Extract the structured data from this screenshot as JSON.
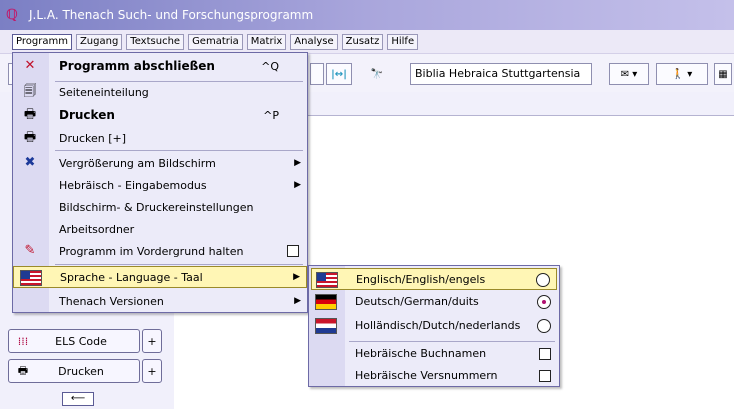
{
  "window": {
    "title": "J.L.A. Thenach Such- und Forschungsprogramm"
  },
  "menubar": {
    "items": [
      "Programm",
      "Zugang",
      "Textsuche",
      "Gematria",
      "Matrix",
      "Analyse",
      "Zusatz",
      "Hilfe"
    ]
  },
  "toolbar": {
    "bible_combo": "Biblia Hebraica Stuttgartensia"
  },
  "menu": {
    "items": [
      {
        "label": "Programm abschließen",
        "shortcut": "^Q",
        "icon": "close-x-icon"
      },
      {
        "label": "Seiteneinteilung",
        "icon": "page-layout-icon"
      },
      {
        "label": "Drucken",
        "shortcut": "^P",
        "icon": "printer-icon"
      },
      {
        "label": "Drucken [+]",
        "icon": "printer-icon"
      },
      {
        "label": "Vergrößerung am Bildschirm",
        "icon": "zoom-tools-icon"
      },
      {
        "label": "Hebräisch - Eingabemodus"
      },
      {
        "label": "Bildschirm- & Druckereinstellungen"
      },
      {
        "label": "Arbeitsordner"
      },
      {
        "label": "Programm im Vordergrund halten",
        "icon": "pin-icon"
      },
      {
        "label": "Sprache - Language - Taal",
        "icon": "us-flag-icon"
      },
      {
        "label": "Thenach Versionen"
      }
    ]
  },
  "submenu": {
    "items": [
      {
        "label": "Englisch/English/engels",
        "icon": "us-flag-icon",
        "selected": false
      },
      {
        "label": "Deutsch/German/duits",
        "icon": "german-flag-icon",
        "selected": true
      },
      {
        "label": "Holländisch/Dutch/nederlands",
        "icon": "dutch-flag-icon",
        "selected": false
      },
      {
        "label": "Hebräische Buchnamen"
      },
      {
        "label": "Hebräische Versnummern"
      }
    ]
  },
  "leftpanel": {
    "els_label": "ELS Code",
    "print_label": "Drucken",
    "plus": "+",
    "back": "⟵"
  }
}
